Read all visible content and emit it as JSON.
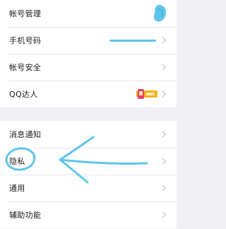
{
  "settings": {
    "group1": [
      {
        "key": "account",
        "label": "帐号管理"
      },
      {
        "key": "phone",
        "label": "手机号码"
      },
      {
        "key": "security",
        "label": "帐号安全"
      },
      {
        "key": "qq_expert",
        "label": "QQ达人"
      }
    ],
    "group2": [
      {
        "key": "notify",
        "label": "消息通知"
      },
      {
        "key": "privacy",
        "label": "隐私"
      },
      {
        "key": "general",
        "label": "通用"
      },
      {
        "key": "accessibility",
        "label": "辅助功能"
      }
    ]
  },
  "icons": {
    "chevron": "chevron-right-icon",
    "avatar": "avatar",
    "qq_expert_badge": "qq-expert-badge-icon"
  },
  "colors": {
    "annotation": "#5ec5ea",
    "chevron": "#c7c7cc",
    "divider": "#e6e6ea",
    "background": "#efeff4"
  }
}
